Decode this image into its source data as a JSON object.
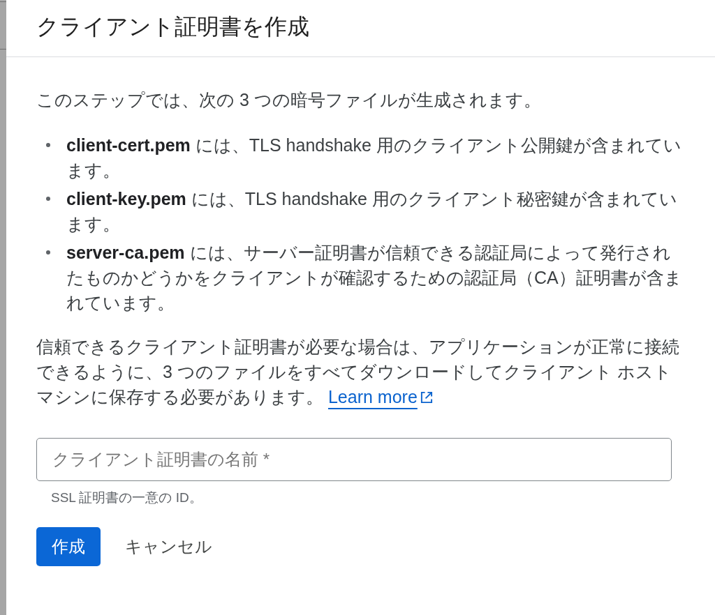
{
  "dialog": {
    "title": "クライアント証明書を作成",
    "intro": "このステップでは、次の 3 つの暗号ファイルが生成されます。",
    "files": [
      {
        "text": "**client-cert.pem** には、TLS handshake 用のクライアント公開鍵が含まれています。"
      },
      {
        "text": "**client-key.pem** には、TLS handshake 用のクライアント秘密鍵が含まれています。"
      },
      {
        "text": "**server-ca.pem** には、サーバー証明書が信頼できる認証局によって発行されたものかどうかをクライアントが確認するための認証局（CA）証明書が含まれています。"
      }
    ],
    "note": "信頼できるクライアント証明書が必要な場合は、アプリケーションが正常に接続できるように、3 つのファイルをすべてダウンロードしてクライアント ホストマシンに保存する必要があります。",
    "learn_more_link": "Learn more",
    "name_field": {
      "placeholder": "クライアント証明書の名前 *",
      "helper_text": "SSL 証明書の一意の ID。"
    },
    "buttons": [
      {
        "label": "作成",
        "kind": "primary"
      },
      {
        "label": "キャンセル",
        "kind": "text"
      }
    ]
  }
}
